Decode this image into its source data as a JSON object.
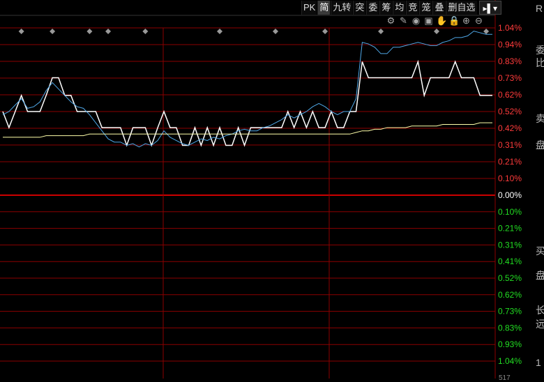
{
  "toolbar": {
    "buttons": [
      {
        "label": "PK",
        "active": false,
        "name": "pk"
      },
      {
        "label": "简",
        "active": true,
        "name": "simple"
      },
      {
        "label": "九转",
        "active": false,
        "name": "nine-turns"
      },
      {
        "label": "突",
        "active": false,
        "name": "breakout"
      },
      {
        "label": "委",
        "active": false,
        "name": "order"
      },
      {
        "label": "筹",
        "active": false,
        "name": "chips"
      },
      {
        "label": "均",
        "active": false,
        "name": "average"
      },
      {
        "label": "竞",
        "active": false,
        "name": "auction"
      },
      {
        "label": "笼",
        "active": false,
        "name": "cage"
      },
      {
        "label": "叠",
        "active": false,
        "name": "overlay"
      },
      {
        "label": "删自选",
        "active": false,
        "name": "remove-watchlist"
      }
    ],
    "more_label": "▸▌▾"
  },
  "tool_icons": [
    "settings-icon",
    "pen-icon",
    "eye-icon",
    "basket-icon",
    "hand-icon",
    "lock-icon",
    "zoom-in-icon",
    "zoom-out-icon"
  ],
  "side_chars": [
    "R",
    "委",
    "比",
    "卖",
    "盘",
    "买",
    "盘",
    "长",
    "远",
    "1"
  ],
  "bottom_label": "517",
  "colors": {
    "up": "#ff3b3b",
    "down": "#22dd22",
    "grid": "#8b0000",
    "price": "#ffffff",
    "avg": "#ffffaa",
    "blue": "#4fa8e8",
    "marker": "#999999"
  },
  "chart_data": {
    "type": "line",
    "y_ticks_top": [
      "1.04%",
      "0.94%",
      "0.83%",
      "0.73%",
      "0.62%",
      "0.52%",
      "0.42%",
      "0.31%",
      "0.21%",
      "0.10%"
    ],
    "y_zero": "0.00%",
    "y_ticks_bottom": [
      "0.10%",
      "0.21%",
      "0.31%",
      "0.41%",
      "0.52%",
      "0.62%",
      "0.73%",
      "0.83%",
      "0.93%",
      "1.04%"
    ],
    "ylim_pct": [
      -1.04,
      1.04
    ],
    "x_count": 80,
    "series": [
      {
        "values": [
          0.52,
          0.42,
          0.52,
          0.62,
          0.52,
          0.52,
          0.52,
          0.62,
          0.73,
          0.73,
          0.62,
          0.62,
          0.52,
          0.52,
          0.52,
          0.52,
          0.42,
          0.42,
          0.42,
          0.42,
          0.31,
          0.42,
          0.42,
          0.42,
          0.31,
          0.42,
          0.52,
          0.42,
          0.42,
          0.31,
          0.31,
          0.42,
          0.31,
          0.42,
          0.31,
          0.42,
          0.31,
          0.31,
          0.42,
          0.31,
          0.42,
          0.42,
          0.42,
          0.42,
          0.42,
          0.42,
          0.52,
          0.42,
          0.52,
          0.42,
          0.52,
          0.42,
          0.42,
          0.52,
          0.42,
          0.42,
          0.52,
          0.52,
          0.83,
          0.73,
          0.73,
          0.73,
          0.73,
          0.73,
          0.73,
          0.73,
          0.73,
          0.83,
          0.62,
          0.73,
          0.73,
          0.73,
          0.73,
          0.83,
          0.73,
          0.73,
          0.73,
          0.62,
          0.62,
          0.62
        ]
      },
      {
        "values": [
          0.5,
          0.52,
          0.56,
          0.6,
          0.54,
          0.55,
          0.58,
          0.65,
          0.7,
          0.66,
          0.62,
          0.58,
          0.55,
          0.54,
          0.5,
          0.45,
          0.4,
          0.35,
          0.33,
          0.33,
          0.31,
          0.32,
          0.3,
          0.32,
          0.31,
          0.34,
          0.4,
          0.36,
          0.34,
          0.32,
          0.31,
          0.33,
          0.35,
          0.34,
          0.36,
          0.35,
          0.37,
          0.38,
          0.4,
          0.41,
          0.4,
          0.4,
          0.42,
          0.43,
          0.45,
          0.47,
          0.5,
          0.48,
          0.5,
          0.52,
          0.55,
          0.57,
          0.55,
          0.52,
          0.5,
          0.52,
          0.52,
          0.6,
          0.95,
          0.94,
          0.92,
          0.88,
          0.88,
          0.92,
          0.92,
          0.93,
          0.94,
          0.95,
          0.94,
          0.93,
          0.93,
          0.95,
          0.96,
          0.98,
          0.98,
          0.99,
          1.02,
          1.01,
          1.0,
          1.0
        ]
      },
      {
        "values": [
          0.36,
          0.36,
          0.36,
          0.36,
          0.36,
          0.36,
          0.36,
          0.37,
          0.37,
          0.37,
          0.37,
          0.37,
          0.37,
          0.37,
          0.38,
          0.38,
          0.38,
          0.38,
          0.38,
          0.38,
          0.38,
          0.38,
          0.38,
          0.38,
          0.38,
          0.38,
          0.38,
          0.38,
          0.38,
          0.38,
          0.38,
          0.38,
          0.38,
          0.38,
          0.38,
          0.38,
          0.38,
          0.38,
          0.38,
          0.38,
          0.38,
          0.38,
          0.38,
          0.38,
          0.38,
          0.38,
          0.38,
          0.38,
          0.38,
          0.38,
          0.38,
          0.38,
          0.38,
          0.38,
          0.38,
          0.38,
          0.38,
          0.39,
          0.4,
          0.4,
          0.41,
          0.41,
          0.42,
          0.42,
          0.42,
          0.42,
          0.43,
          0.43,
          0.43,
          0.43,
          0.43,
          0.44,
          0.44,
          0.44,
          0.44,
          0.44,
          0.44,
          0.45,
          0.45,
          0.45
        ]
      }
    ],
    "markers_x_index": [
      3,
      8,
      14,
      17,
      23,
      35,
      44,
      52,
      61,
      70,
      78
    ]
  }
}
